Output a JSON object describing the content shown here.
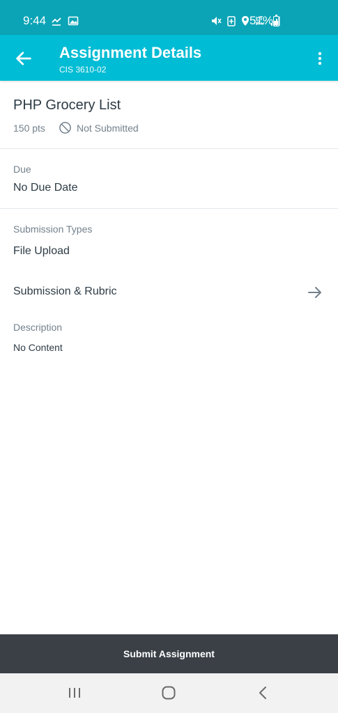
{
  "status_bar": {
    "time": "9:44",
    "battery": "51%"
  },
  "app_bar": {
    "title": "Assignment Details",
    "subtitle": "CIS 3610-02"
  },
  "assignment": {
    "title": "PHP Grocery List",
    "points": "150 pts",
    "submission_status": "Not Submitted"
  },
  "due": {
    "label": "Due",
    "value": "No Due Date"
  },
  "submission_types": {
    "label": "Submission Types",
    "value": "File Upload"
  },
  "rubric": {
    "label": "Submission & Rubric"
  },
  "description": {
    "label": "Description",
    "value": "No Content"
  },
  "submit": {
    "label": "Submit Assignment"
  },
  "colors": {
    "status_bar": "#0aa4b6",
    "app_bar": "#00bcd4",
    "submit_bar": "#3b4047"
  },
  "icons": {
    "back": "arrow-left-icon",
    "more": "more-vertical-icon",
    "not_submitted": "no-symbol-icon",
    "rubric": "arrow-right-icon",
    "nav": [
      "recent-apps-icon",
      "home-icon",
      "back-nav-icon"
    ]
  }
}
